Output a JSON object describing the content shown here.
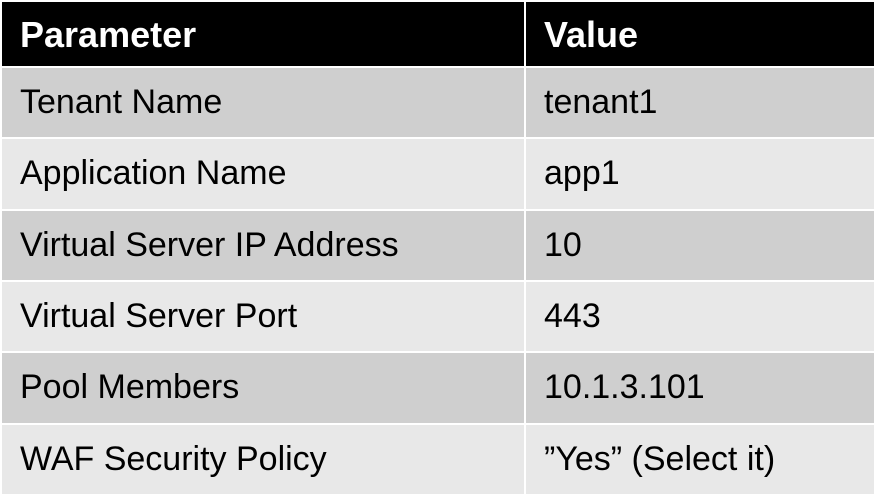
{
  "table": {
    "headers": [
      "Parameter",
      "Value"
    ],
    "rows": [
      [
        "Tenant Name",
        "tenant1"
      ],
      [
        "Application Name",
        "app1"
      ],
      [
        "Virtual Server IP Address",
        "10"
      ],
      [
        "Virtual Server Port",
        "443"
      ],
      [
        "Pool Members",
        "10.1.3.101"
      ],
      [
        "WAF Security Policy",
        "”Yes” (Select it)"
      ]
    ]
  },
  "colors": {
    "header_bg": "#000000",
    "header_text": "#ffffff",
    "row_odd_bg": "#cfcfcf",
    "row_even_bg": "#e8e8e8",
    "divider": "#ffffff"
  }
}
